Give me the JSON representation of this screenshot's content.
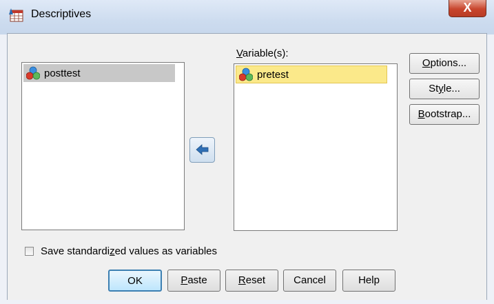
{
  "window": {
    "title": "Descriptives",
    "close_glyph": "X"
  },
  "source_list": {
    "items": [
      {
        "label": "posttest",
        "icon": "nominal-variable-icon"
      }
    ]
  },
  "target_list": {
    "label": "Variable(s):",
    "items": [
      {
        "label": "pretest",
        "icon": "nominal-variable-icon",
        "selected": true
      }
    ]
  },
  "move_button": {
    "icon": "arrow-left-icon"
  },
  "side_buttons": {
    "options": "Options...",
    "style": "Style...",
    "bootstrap": "Bootstrap..."
  },
  "save_checkbox": {
    "label": "Save standardized values as variables",
    "checked": false
  },
  "bottom_buttons": {
    "ok": "OK",
    "paste": "Paste",
    "reset": "Reset",
    "cancel": "Cancel",
    "help": "Help"
  },
  "colors": {
    "selected_highlight": "#fbe98a",
    "source_highlight": "#c8c8c8",
    "arrow": "#2f6fb5",
    "close_red": "#c8452d"
  }
}
